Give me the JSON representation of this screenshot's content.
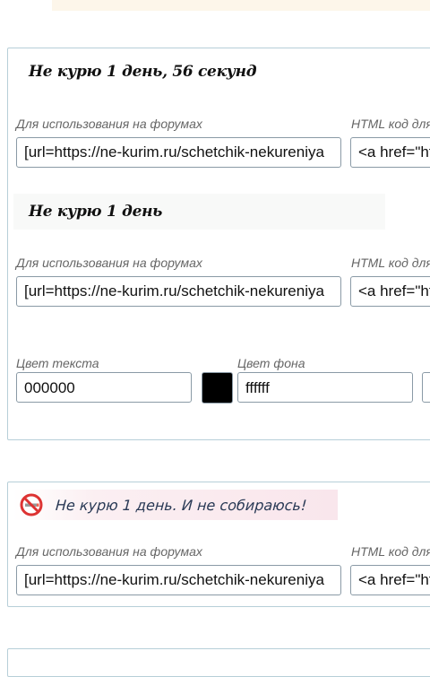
{
  "counters": [
    {
      "text": "Не курю 1 день, 56 секунд",
      "forum_label": "Для использования на форумах",
      "forum_value": "[url=https://ne-kurim.ru/schetchik-nekureniya",
      "html_label": "HTML код для",
      "html_value": "<a href=\"https://ne-kurim.ru"
    },
    {
      "text": "Не курю 1 день",
      "forum_label": "Для использования на форумах",
      "forum_value": "[url=https://ne-kurim.ru/schetchik-nekureniya",
      "html_label": "HTML код для",
      "html_value": "<a href=\"https://ne-kurim.ru"
    },
    {
      "text": "Не курю 1 день. И не собираюсь!",
      "icon": "no-smoking-icon",
      "forum_label": "Для использования на форумах",
      "forum_value": "[url=https://ne-kurim.ru/schetchik-nekureniya",
      "html_label": "HTML код для",
      "html_value": "<a href=\"https://ne-kurim.ru"
    }
  ],
  "colors": {
    "text_color_label": "Цвет текста",
    "text_color_value": "000000",
    "bg_color_label": "Цвет фона",
    "bg_color_value": "ffffff",
    "text_swatch": "#000000"
  }
}
